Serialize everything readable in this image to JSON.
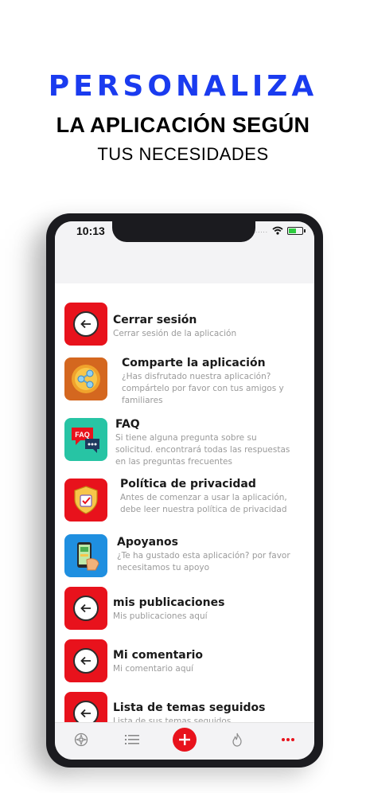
{
  "headline": {
    "line1": "PERSONALIZA",
    "line2": "LA APLICACIÓN SEGÚN",
    "line3": "TUS NECESIDADES"
  },
  "status_bar": {
    "time": "10:13",
    "dots": "....."
  },
  "colors": {
    "accent_red": "#e8121c",
    "headline_blue": "#1a3bef"
  },
  "menu": {
    "items": [
      {
        "title": "Cerrar sesión",
        "desc": "Cerrar sesión de la aplicación",
        "icon": "logout-icon"
      },
      {
        "title": "Comparte la aplicación",
        "desc": "¿Has disfrutado nuestra aplicación? compártelo por favor con tus amigos y familiares",
        "icon": "share-icon"
      },
      {
        "title": "FAQ",
        "desc": "Si tiene alguna pregunta sobre su solicitud. encontrará todas las respuestas en las preguntas frecuentes",
        "icon": "faq-icon"
      },
      {
        "title": "Política de privacidad",
        "desc": "Antes de comenzar a usar la aplicación, debe leer nuestra política de privacidad",
        "icon": "privacy-shield-icon"
      },
      {
        "title": "Apoyanos",
        "desc": "¿Te ha gustado esta aplicación? por favor necesitamos tu apoyo",
        "icon": "support-phone-icon"
      },
      {
        "title": "mis publicaciones",
        "desc": "Mis publicaciones aquí",
        "icon": "back-arrow-icon"
      },
      {
        "title": "Mi comentario",
        "desc": "Mi comentario aquí",
        "icon": "back-arrow-icon"
      },
      {
        "title": "Lista de temas seguidos",
        "desc": "Lista de sus temas seguidos",
        "icon": "back-arrow-icon"
      }
    ]
  },
  "tabbar": {
    "tabs": [
      "compass-icon",
      "list-icon",
      "add-icon",
      "flame-icon",
      "more-dots-icon"
    ]
  }
}
